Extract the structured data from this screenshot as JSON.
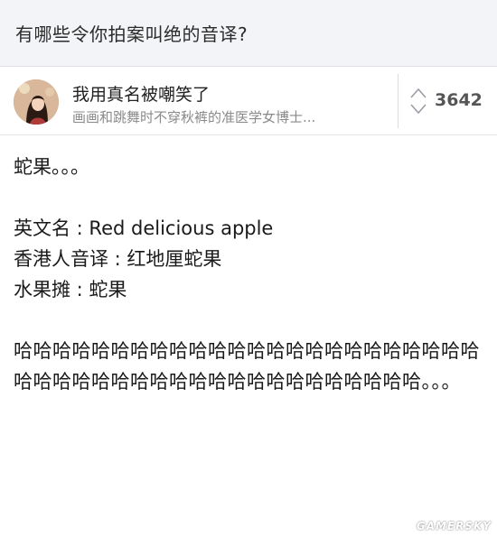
{
  "question": {
    "title": "有哪些令你拍案叫绝的音译?"
  },
  "author": {
    "name": "我用真名被嘲笑了",
    "bio": "画画和跳舞时不穿秋裤的准医学女博士..."
  },
  "vote": {
    "icon": "up-down-chevron-icon",
    "count": "3642"
  },
  "answer": {
    "line1": "蛇果。。。",
    "line2": "英文名 : Red delicious apple",
    "line3": "香港人音译 : 红地厘蛇果",
    "line4": "水果摊 : 蛇果",
    "laugh": "哈哈哈哈哈哈哈哈哈哈哈哈哈哈哈哈哈哈哈哈哈哈哈哈哈哈哈哈哈哈哈哈哈哈哈哈哈哈哈哈哈哈哈哈哈。。。"
  },
  "watermark": {
    "text": "GAMERSKY"
  },
  "colors": {
    "question_bg": "#f3f4f7",
    "vote_count": "#555555",
    "bio": "#8a8a8a"
  }
}
